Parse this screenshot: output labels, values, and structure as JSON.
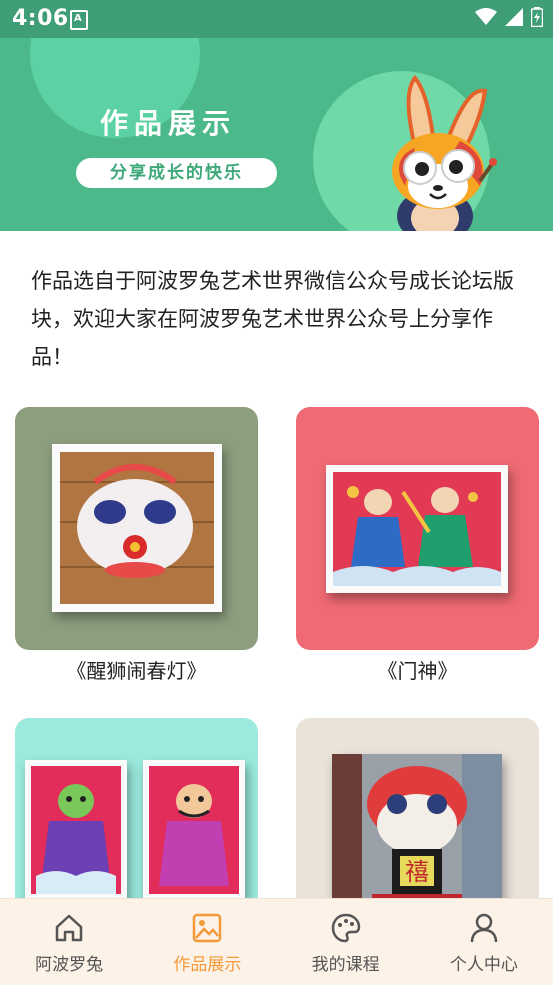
{
  "status_bar": {
    "time": "4:06",
    "sim_label": "A"
  },
  "banner": {
    "title": "作品展示",
    "subtitle": "分享成长的快乐"
  },
  "intro_text": "作品选自于阿波罗兔艺术世界微信公众号成长论坛版块，欢迎大家在阿波罗兔艺术世界公众号上分享作品！",
  "gallery": [
    {
      "caption": "《醒狮闹春灯》"
    },
    {
      "caption": "《门神》"
    },
    {
      "caption": ""
    },
    {
      "caption": ""
    }
  ],
  "bottom_nav": [
    {
      "label": "阿波罗兔",
      "icon": "home-icon",
      "active": false
    },
    {
      "label": "作品展示",
      "icon": "gallery-icon",
      "active": true
    },
    {
      "label": "我的课程",
      "icon": "palette-icon",
      "active": false
    },
    {
      "label": "个人中心",
      "icon": "person-icon",
      "active": false
    }
  ],
  "colors": {
    "banner": "#4cb98a",
    "active_nav": "#f39b3a",
    "nav_bg": "#fdf2e8"
  }
}
